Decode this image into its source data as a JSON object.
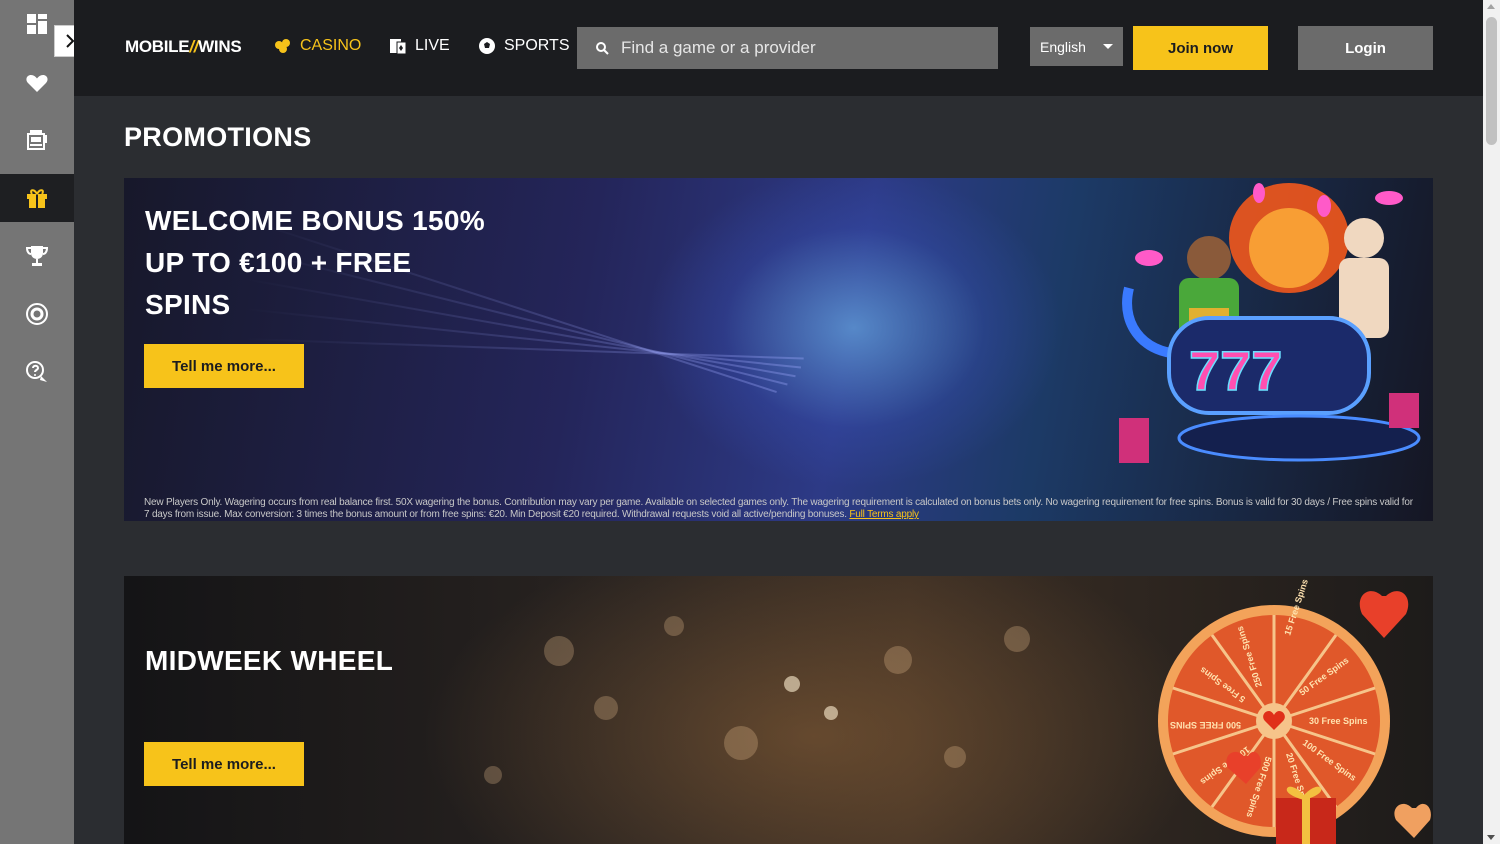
{
  "header": {
    "logo_left": "MOBILE",
    "logo_slash": "//",
    "logo_right": "WINS",
    "nav": {
      "casino": "CASINO",
      "live": "LIVE",
      "sports": "SPORTS"
    },
    "search_placeholder": "Find a game or a provider",
    "language": "English",
    "join_label": "Join now",
    "login_label": "Login"
  },
  "sidebar": {
    "items": [
      "dashboard-icon",
      "heart-icon",
      "slot-machine-icon",
      "gift-icon",
      "trophy-icon",
      "lifebuoy-icon",
      "help-chat-icon"
    ],
    "active": "gift-icon"
  },
  "main": {
    "title": "PROMOTIONS",
    "promos": [
      {
        "title_line1": "WELCOME BONUS 150%",
        "title_line2": "UP TO €100 + FREE",
        "title_line3": "SPINS",
        "button": "Tell me more...",
        "terms": "New Players Only. Wagering occurs from real balance first. 50X wagering the bonus. Contribution may vary per game. Available on selected games only. The wagering requirement is calculated on bonus bets only. No wagering requirement for free spins. Bonus is valid for 30 days / Free spins valid for 7 days from issue. Max conversion: 3 times the bonus amount or from free spins: €20. Min Deposit €20 required. Withdrawal requests void all active/pending bonuses.",
        "terms_link": "Full Terms apply",
        "slot_digits": "777"
      },
      {
        "title_line1": "MIDWEEK WHEEL",
        "button": "Tell me more...",
        "wheel_segments": [
          "15 Free Spins",
          "50 Free Spins",
          "30 Free Spins",
          "100 Free Spins",
          "20 Free Spins",
          "500 Free Spins",
          "10 Free Spins",
          "500 FREE SPINS",
          "5 Free Spins",
          "250 Free Spins"
        ]
      }
    ]
  },
  "colors": {
    "accent": "#f7c31a",
    "header_bg": "#1b1c1f",
    "sidebar_bg": "#757575",
    "page_bg": "#2b2d31"
  }
}
